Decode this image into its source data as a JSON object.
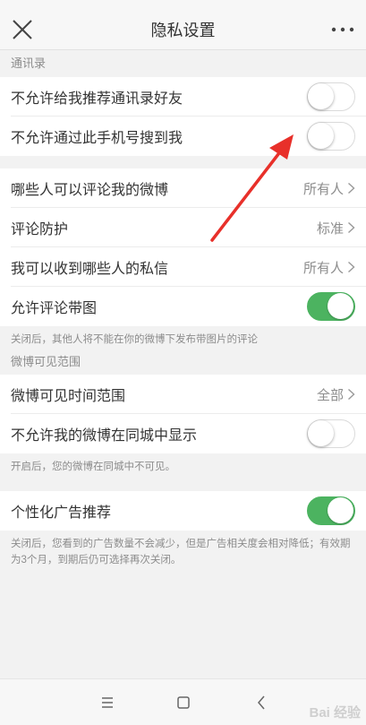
{
  "nav": {
    "title": "隐私设置"
  },
  "contacts": {
    "header": "通讯录",
    "items": [
      {
        "label": "不允许给我推荐通讯录好友",
        "toggle": "off"
      },
      {
        "label": "不允许通过此手机号搜到我",
        "toggle": "off"
      }
    ]
  },
  "interaction": {
    "items": [
      {
        "label": "哪些人可以评论我的微博",
        "value": "所有人"
      },
      {
        "label": "评论防护",
        "value": "标准"
      },
      {
        "label": "我可以收到哪些人的私信",
        "value": "所有人"
      },
      {
        "label": "允许评论带图",
        "toggle": "on"
      }
    ],
    "note": "关闭后，其他人将不能在你的微博下发布带图片的评论"
  },
  "visibility": {
    "header": "微博可见范围",
    "items": [
      {
        "label": "微博可见时间范围",
        "value": "全部"
      },
      {
        "label": "不允许我的微博在同城中显示",
        "toggle": "off"
      }
    ],
    "note": "开启后，您的微博在同城中不可见。"
  },
  "ads": {
    "items": [
      {
        "label": "个性化广告推荐",
        "toggle": "on"
      }
    ],
    "note": "关闭后，您看到的广告数量不会减少，但是广告相关度会相对降低；有效期为3个月，到期后仍可选择再次关闭。"
  },
  "watermark": "Bai 经验",
  "colors": {
    "toggle_on": "#4cb360",
    "annotation_arrow": "#e8302a"
  }
}
